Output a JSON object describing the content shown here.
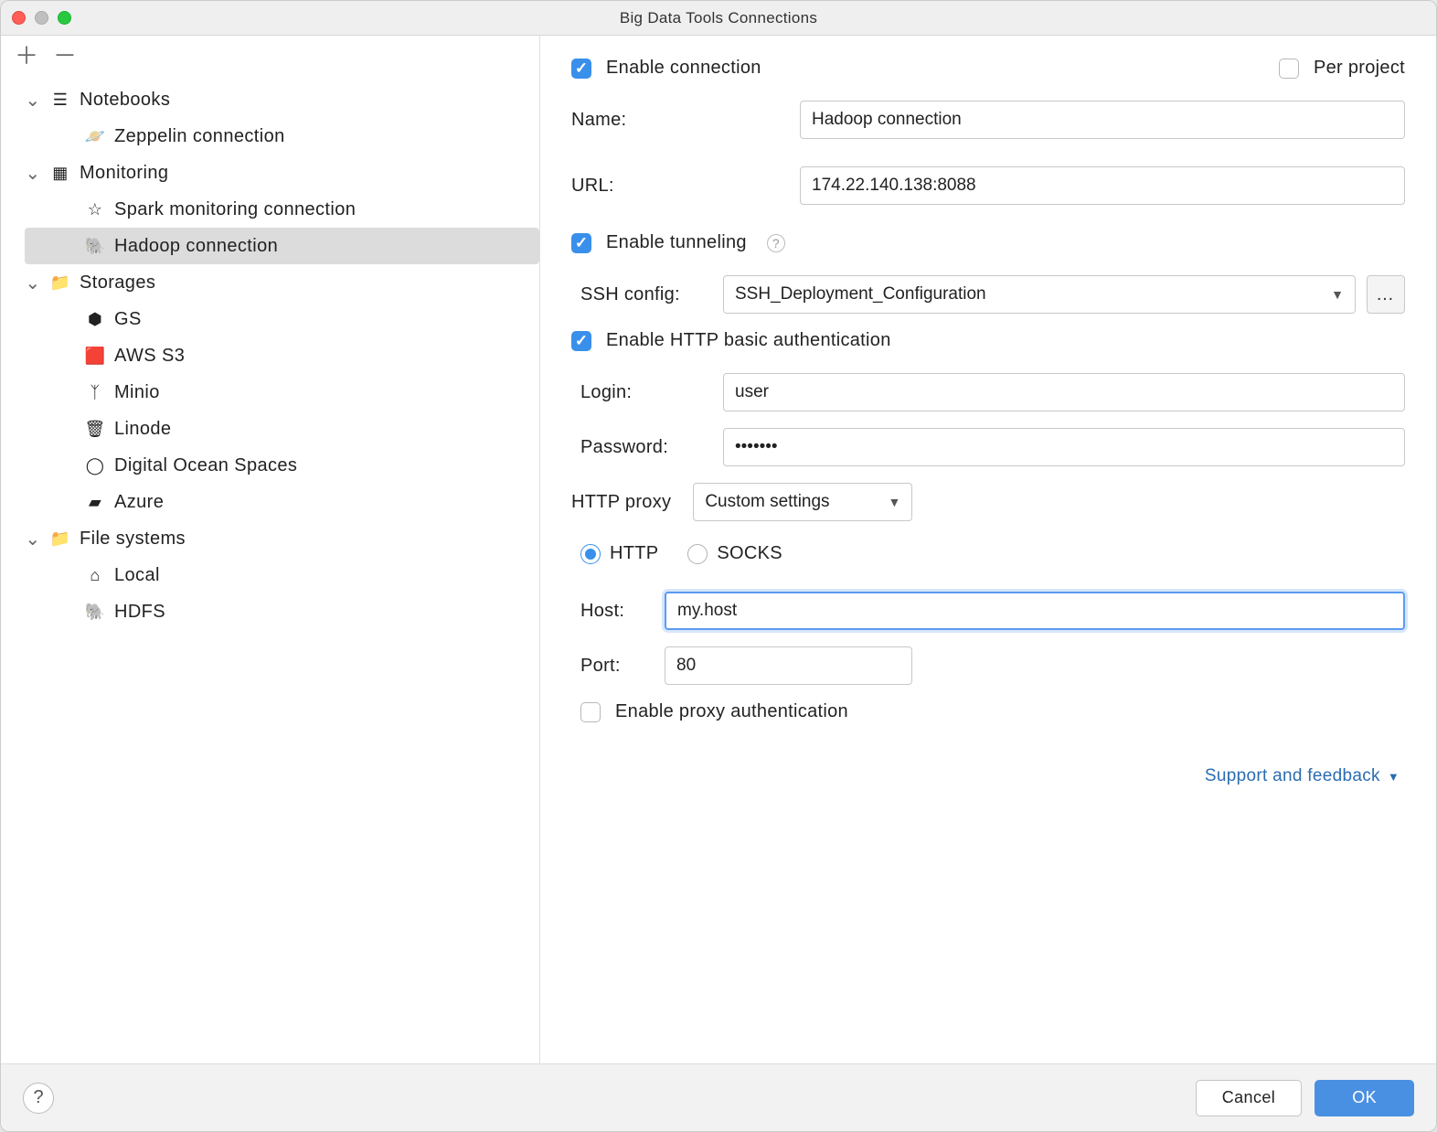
{
  "window": {
    "title": "Big Data Tools Connections"
  },
  "sidebar": {
    "categories": [
      {
        "label": "Notebooks",
        "icon": "notebook-icon",
        "items": [
          {
            "label": "Zeppelin connection",
            "icon": "zeppelin-icon"
          }
        ]
      },
      {
        "label": "Monitoring",
        "icon": "grid-icon",
        "items": [
          {
            "label": "Spark monitoring connection",
            "icon": "star-icon"
          },
          {
            "label": "Hadoop connection",
            "icon": "hadoop-icon",
            "selected": true
          }
        ]
      },
      {
        "label": "Storages",
        "icon": "folder-storage-icon",
        "items": [
          {
            "label": "GS",
            "icon": "gs-icon"
          },
          {
            "label": "AWS S3",
            "icon": "aws-icon"
          },
          {
            "label": "Minio",
            "icon": "minio-icon"
          },
          {
            "label": "Linode",
            "icon": "linode-icon"
          },
          {
            "label": "Digital Ocean Spaces",
            "icon": "digitalocean-icon"
          },
          {
            "label": "Azure",
            "icon": "azure-icon"
          }
        ]
      },
      {
        "label": "File systems",
        "icon": "folder-icon",
        "items": [
          {
            "label": "Local",
            "icon": "home-icon"
          },
          {
            "label": "HDFS",
            "icon": "hdfs-icon"
          }
        ]
      }
    ]
  },
  "form": {
    "enable_connection_label": "Enable connection",
    "enable_connection_checked": true,
    "per_project_label": "Per project",
    "per_project_checked": false,
    "name_label": "Name:",
    "name_value": "Hadoop connection",
    "url_label": "URL:",
    "url_value": "174.22.140.138:8088",
    "enable_tunneling_label": "Enable tunneling",
    "enable_tunneling_checked": true,
    "ssh_config_label": "SSH config:",
    "ssh_config_value": "SSH_Deployment_Configuration",
    "enable_http_basic_label": "Enable HTTP basic authentication",
    "enable_http_basic_checked": true,
    "login_label": "Login:",
    "login_value": "user",
    "password_label": "Password:",
    "password_value": "•••••••",
    "http_proxy_label": "HTTP proxy",
    "http_proxy_value": "Custom settings",
    "proxy_type_http": "HTTP",
    "proxy_type_socks": "SOCKS",
    "proxy_host_label": "Host:",
    "proxy_host_value": "my.host",
    "proxy_port_label": "Port:",
    "proxy_port_value": "80",
    "enable_proxy_auth_label": "Enable proxy authentication",
    "enable_proxy_auth_checked": false
  },
  "footer": {
    "support_link": "Support and feedback",
    "cancel": "Cancel",
    "ok": "OK"
  },
  "icons": {
    "notebook-icon": "☰",
    "zeppelin-icon": "🪐",
    "grid-icon": "▦",
    "star-icon": "☆",
    "hadoop-icon": "🐘",
    "folder-storage-icon": "📁",
    "gs-icon": "⬢",
    "aws-icon": "🟥",
    "minio-icon": "ᛉ",
    "linode-icon": "🗑",
    "digitalocean-icon": "◯",
    "azure-icon": "▰",
    "folder-icon": "📁",
    "home-icon": "⌂",
    "hdfs-icon": "🐘"
  }
}
